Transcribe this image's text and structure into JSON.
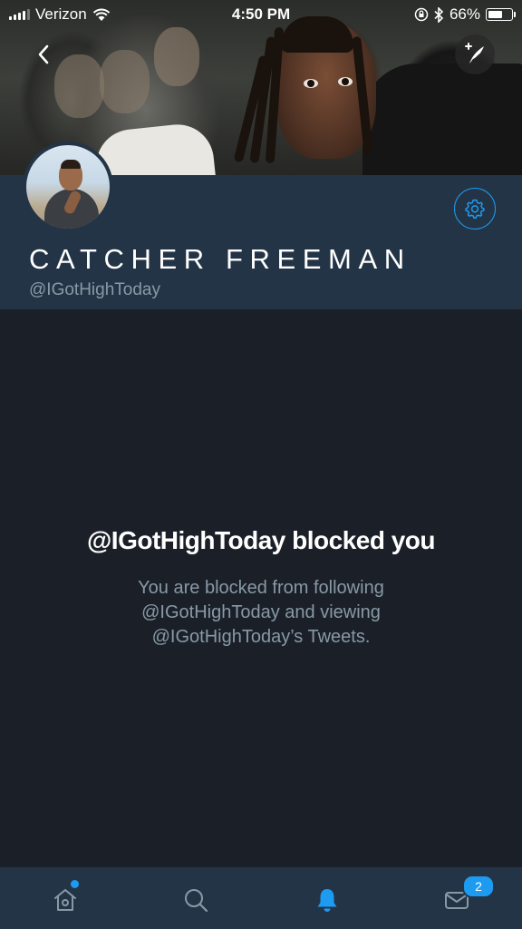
{
  "status_bar": {
    "carrier": "Verizon",
    "time": "4:50 PM",
    "battery_percent": "66%",
    "battery_level": 0.66,
    "icons": [
      "signal-icon",
      "wifi-icon",
      "lock-rotation-icon",
      "bluetooth-icon",
      "battery-icon"
    ]
  },
  "nav": {
    "back_icon": "chevron-left-icon",
    "compose_icon": "compose-tweet-icon"
  },
  "profile": {
    "display_name": "CATCHER FREEMAN",
    "handle": "@IGotHighToday",
    "settings_icon": "gear-icon"
  },
  "blocked": {
    "title": "@IGotHighToday blocked you",
    "description": "You are blocked from following @IGotHighToday and viewing @IGotHighToday’s Tweets."
  },
  "tabbar": {
    "tabs": [
      {
        "name": "home",
        "icon": "home-icon",
        "has_dot": true
      },
      {
        "name": "search",
        "icon": "search-icon"
      },
      {
        "name": "notifications",
        "icon": "bell-icon",
        "active": true
      },
      {
        "name": "messages",
        "icon": "mail-icon",
        "badge": "2"
      }
    ]
  },
  "colors": {
    "accent": "#1d9bf0",
    "background": "#1b2028",
    "panel": "#243447",
    "secondary_text": "#8899a6"
  }
}
